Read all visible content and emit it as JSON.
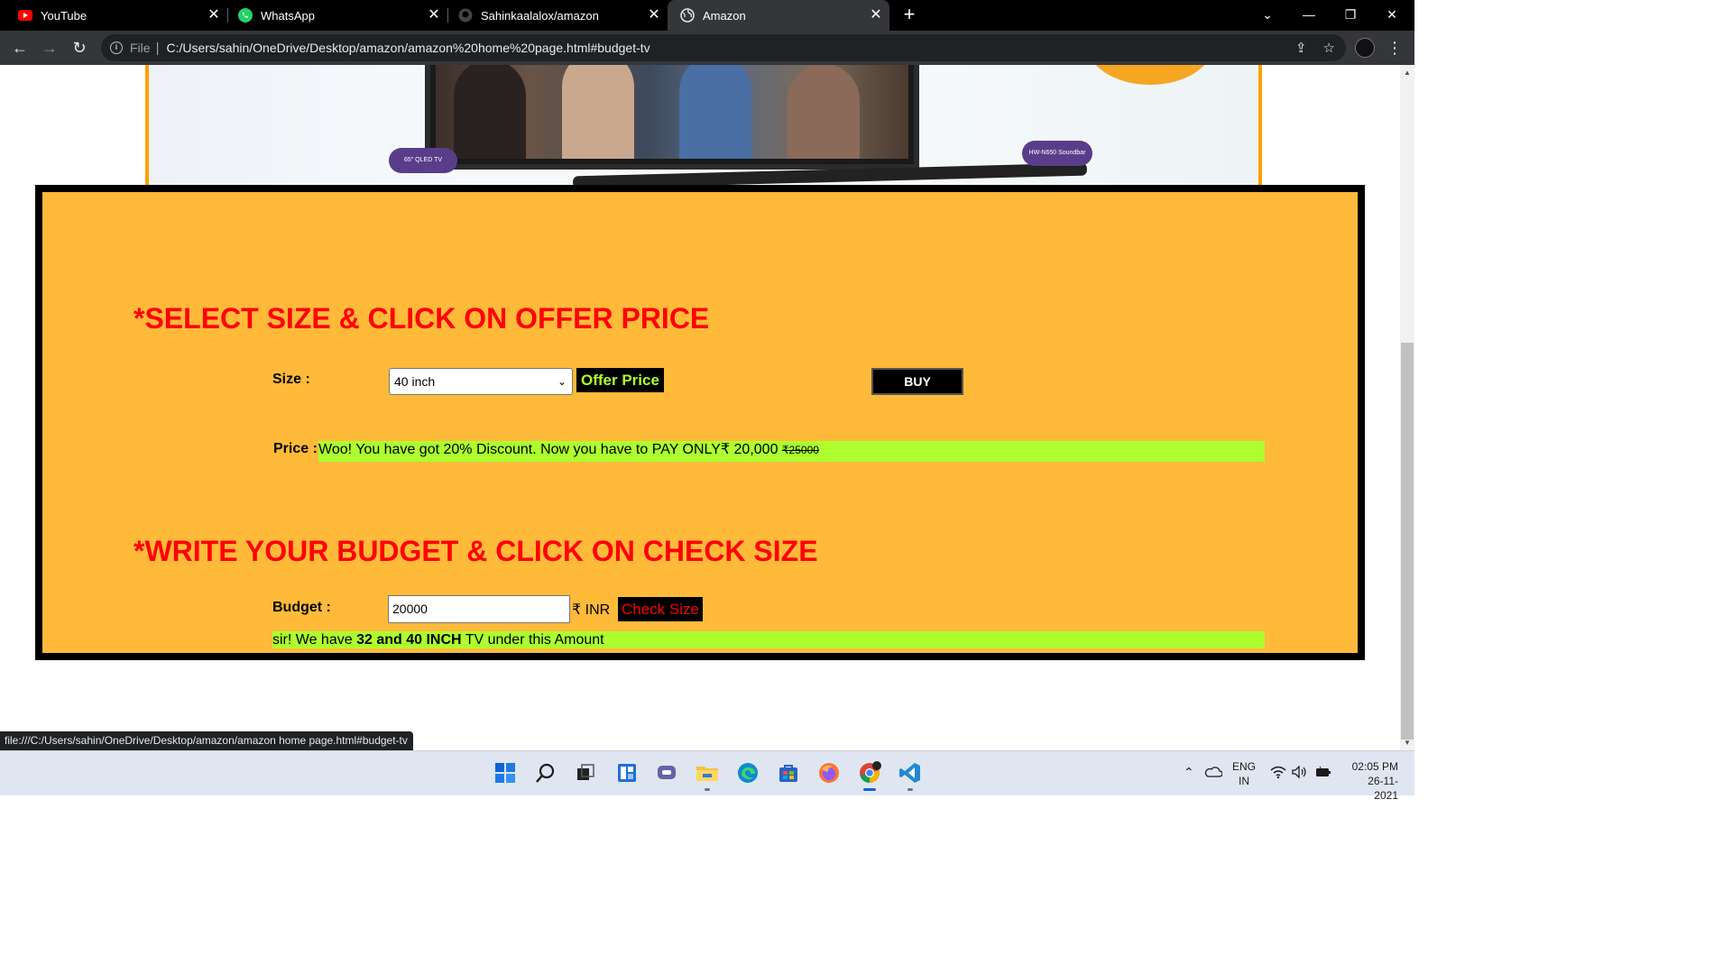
{
  "browser": {
    "tabs": [
      {
        "title": "YouTube",
        "icon": "youtube-icon",
        "active": false
      },
      {
        "title": "WhatsApp",
        "icon": "whatsapp-icon",
        "active": false
      },
      {
        "title": "Sahinkaalalox/amazon",
        "icon": "github-icon",
        "active": false
      },
      {
        "title": "Amazon",
        "icon": "globe-icon",
        "active": true
      }
    ],
    "address": {
      "scheme_label": "File",
      "url": "C:/Users/sahin/OneDrive/Desktop/amazon/amazon%20home%20page.html#budget-tv"
    },
    "status_url": "file:///C:/Users/sahin/OneDrive/Desktop/amazon/amazon home page.html#budget-tv"
  },
  "page": {
    "offer_section": {
      "heading": "*SELECT SIZE & CLICK ON OFFER PRICE",
      "size_label": "Size :",
      "size_selected": "40 inch",
      "offer_button": "Offer Price",
      "buy_button": "BUY",
      "price_label": "Price :",
      "price_message": "Woo! You have got 20% Discount. Now you have to PAY ONLY₹ 20,000 ",
      "old_price": "₹25000"
    },
    "budget_section": {
      "heading": "*WRITE YOUR BUDGET & CLICK ON CHECK SIZE",
      "budget_label": "Budget :",
      "budget_value": "20000",
      "currency": "₹ INR",
      "check_button": "Check Size",
      "result_prefix": "sir! We have ",
      "result_bold": "32 and 40 INCH",
      "result_suffix": " TV under this Amount"
    },
    "banner": {
      "badge_left": "65\" QLED TV",
      "badge_right": "HW-N650 Soundbar"
    }
  },
  "taskbar": {
    "apps": [
      "windows-start-icon",
      "search-icon",
      "task-view-icon",
      "widgets-icon",
      "teams-chat-icon",
      "file-explorer-icon",
      "edge-icon",
      "store-icon",
      "firefox-icon",
      "chrome-icon",
      "vscode-icon"
    ],
    "tray": {
      "language": "ENG",
      "region": "IN",
      "time": "02:05 PM",
      "date": "26-11-2021"
    }
  },
  "colors": {
    "heading_red": "#ff0000",
    "panel_bg": "#ffba3a",
    "highlight_green": "#adff2f",
    "banner_border": "#ff9f00"
  }
}
